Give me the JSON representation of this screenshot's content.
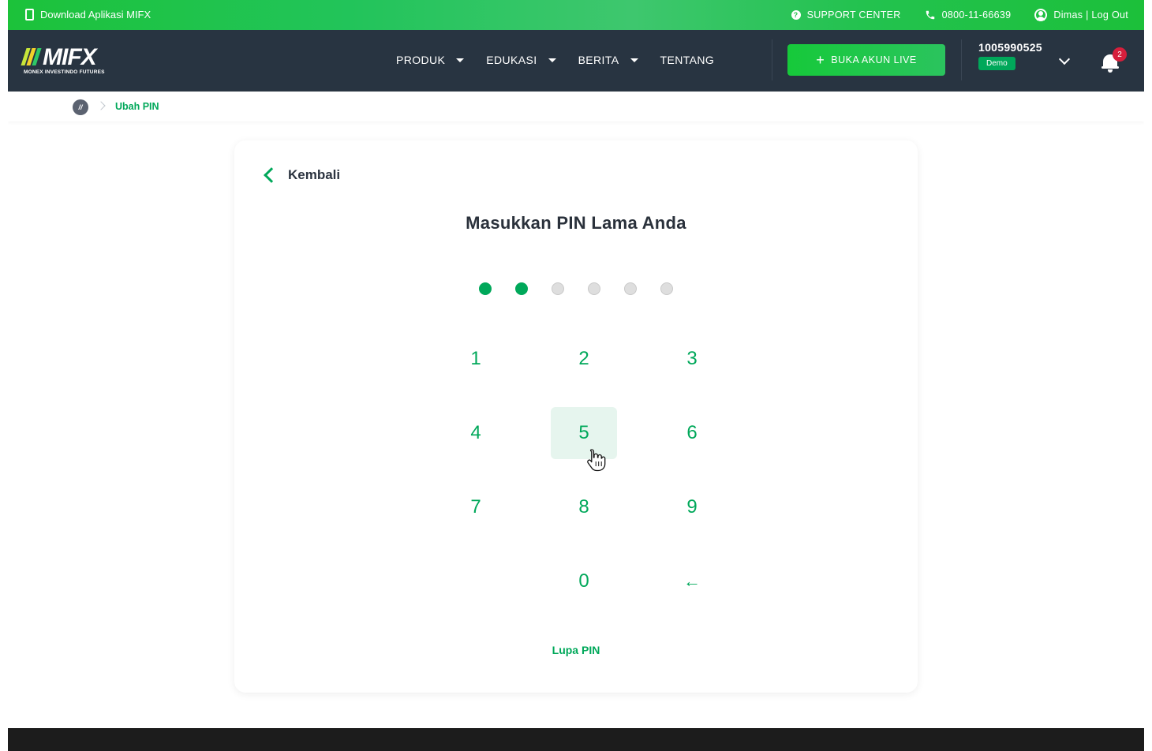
{
  "topbar": {
    "download_label": "Download Aplikasi MIFX",
    "support_label": "SUPPORT CENTER",
    "phone_label": "0800-11-66639",
    "user_label": "Dimas | Log Out"
  },
  "navbar": {
    "logo_text": "MIFX",
    "logo_subtitle": "MONEX INVESTINDO FUTURES",
    "menu": [
      {
        "label": "PRODUK",
        "has_dropdown": true
      },
      {
        "label": "EDUKASI",
        "has_dropdown": true
      },
      {
        "label": "BERITA",
        "has_dropdown": true
      },
      {
        "label": "TENTANG",
        "has_dropdown": false
      }
    ],
    "cta_label": "BUKA AKUN LIVE",
    "account_number": "1005990525",
    "account_type": "Demo",
    "notification_count": "2"
  },
  "breadcrumb": {
    "current": "Ubah PIN"
  },
  "pin": {
    "back_label": "Kembali",
    "title": "Masukkan PIN Lama Anda",
    "length": 6,
    "entered": 2,
    "keys": [
      "1",
      "2",
      "3",
      "4",
      "5",
      "6",
      "7",
      "8",
      "9",
      "0"
    ],
    "backspace_glyph": "←",
    "forgot_label": "Lupa PIN",
    "hovered_key": "5"
  },
  "colors": {
    "brand_green": "#00a85a",
    "topbar_green": "#22c24a",
    "navbar_bg": "#283441",
    "dot_empty": "#dedede",
    "badge_red": "#d61f3c"
  }
}
